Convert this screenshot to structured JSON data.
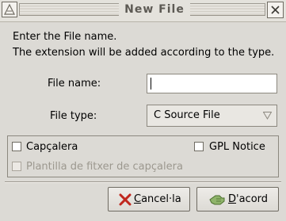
{
  "window": {
    "title": "New File"
  },
  "dialog": {
    "intro_line1": "Enter the File name.",
    "intro_line2": "The extension will be added according to the type.",
    "file_name_label": "File name:",
    "file_name_value": "",
    "file_type_label": "File type:",
    "file_type_value": "C Source File",
    "options": {
      "header_label": "Capçalera",
      "header_checked": false,
      "gpl_label": "GPL Notice",
      "gpl_checked": false,
      "template_label": "Plantilla de fitxer de capçalera",
      "template_checked": false,
      "template_enabled": false
    }
  },
  "buttons": {
    "cancel_first": "C",
    "cancel_rest": "ancel·la",
    "ok_first": "D",
    "ok_rest": "'acord"
  },
  "icons": {
    "window_menu": "window-menu-icon",
    "close": "close-icon",
    "cancel": "cancel-x-icon",
    "ok": "ok-hand-icon",
    "combo": "dropdown-triangle-icon"
  },
  "colors": {
    "background": "#dcdad5",
    "cancel_red": "#c0271e",
    "ok_green": "#5c8a3a"
  }
}
